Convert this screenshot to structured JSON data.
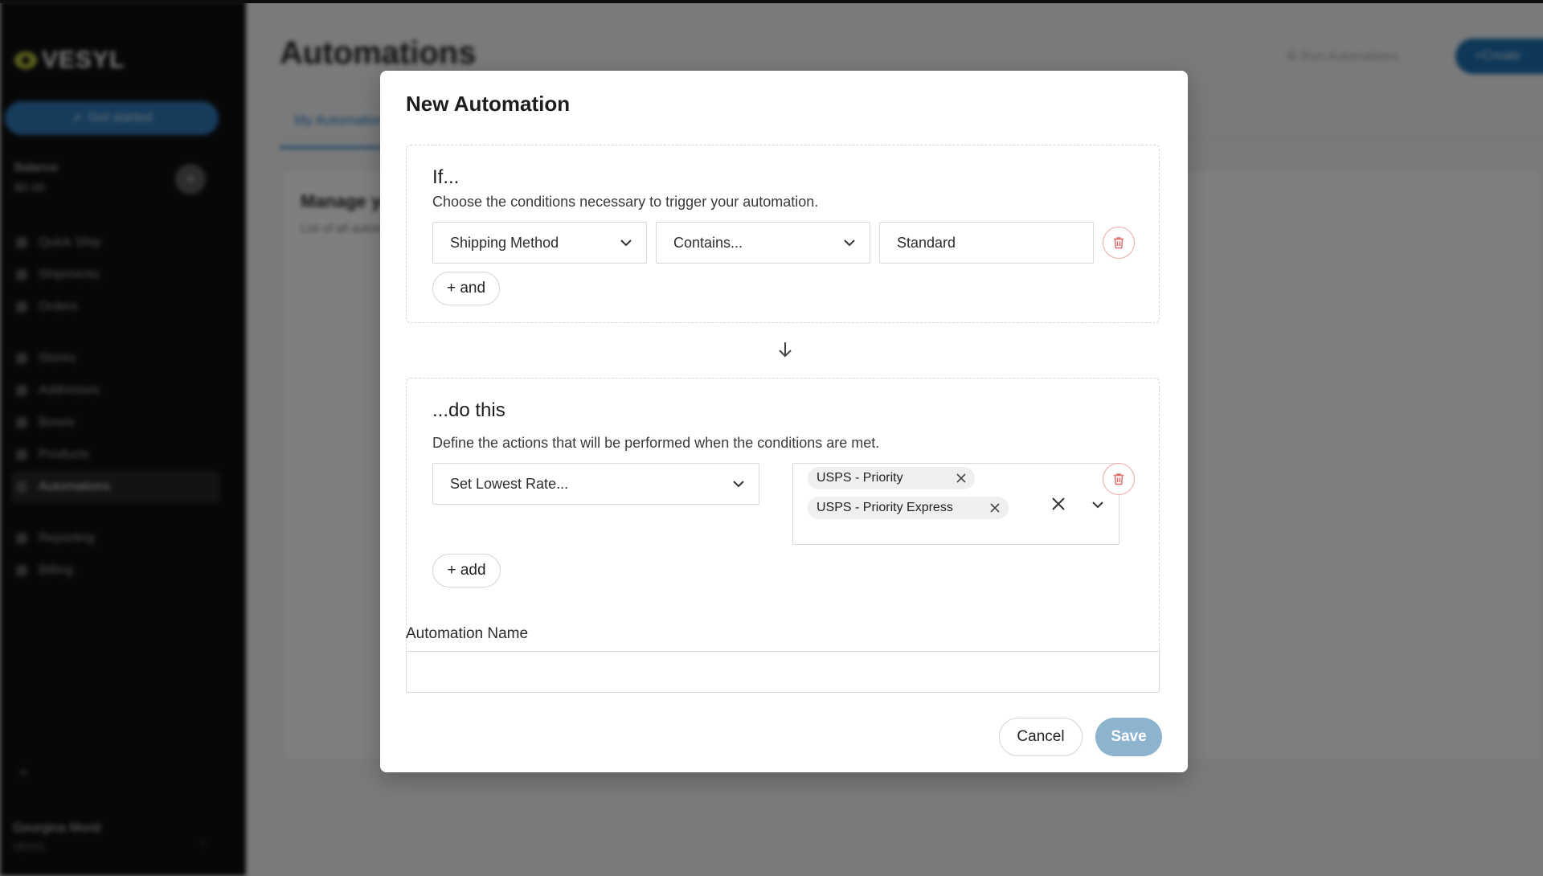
{
  "background": {
    "app_name": "VESYL",
    "get_started_label": "Get started",
    "balance_label": "Balance",
    "balance_value": "$0.00",
    "nav_items": [
      {
        "label": "Quick Ship"
      },
      {
        "label": "Shipments"
      },
      {
        "label": "Orders"
      },
      {
        "label": "Stores"
      },
      {
        "label": "Addresses"
      },
      {
        "label": "Boxes"
      },
      {
        "label": "Products"
      },
      {
        "label": "Automations"
      },
      {
        "label": "Reporting"
      },
      {
        "label": "Billing"
      }
    ],
    "user_name": "Georgina Monti",
    "user_org": "VESYL",
    "page_title": "Automations",
    "run_automations_label": "Run Automations",
    "create_label": "Create",
    "tab_label": "My Automations",
    "card_title": "Manage your automations",
    "card_subtitle": "List of all automations"
  },
  "modal": {
    "title": "New Automation",
    "if_section": {
      "heading": "If...",
      "description": "Choose the conditions necessary to trigger your automation.",
      "condition_field": "Shipping Method",
      "operator": "Contains...",
      "value": "Standard",
      "add_label": "+ and"
    },
    "do_section": {
      "heading": "...do this",
      "description": "Define the actions that will be performed when the conditions are met.",
      "action": "Set Lowest Rate...",
      "selected_options": [
        "USPS - Priority",
        "USPS - Priority Express"
      ],
      "add_label": "+ add"
    },
    "name_label": "Automation Name",
    "name_value": "",
    "cancel_label": "Cancel",
    "save_label": "Save"
  },
  "colors": {
    "save_button": "#8db3cf",
    "trash_icon": "#e26d6d",
    "accent": "#2a7fc4"
  }
}
